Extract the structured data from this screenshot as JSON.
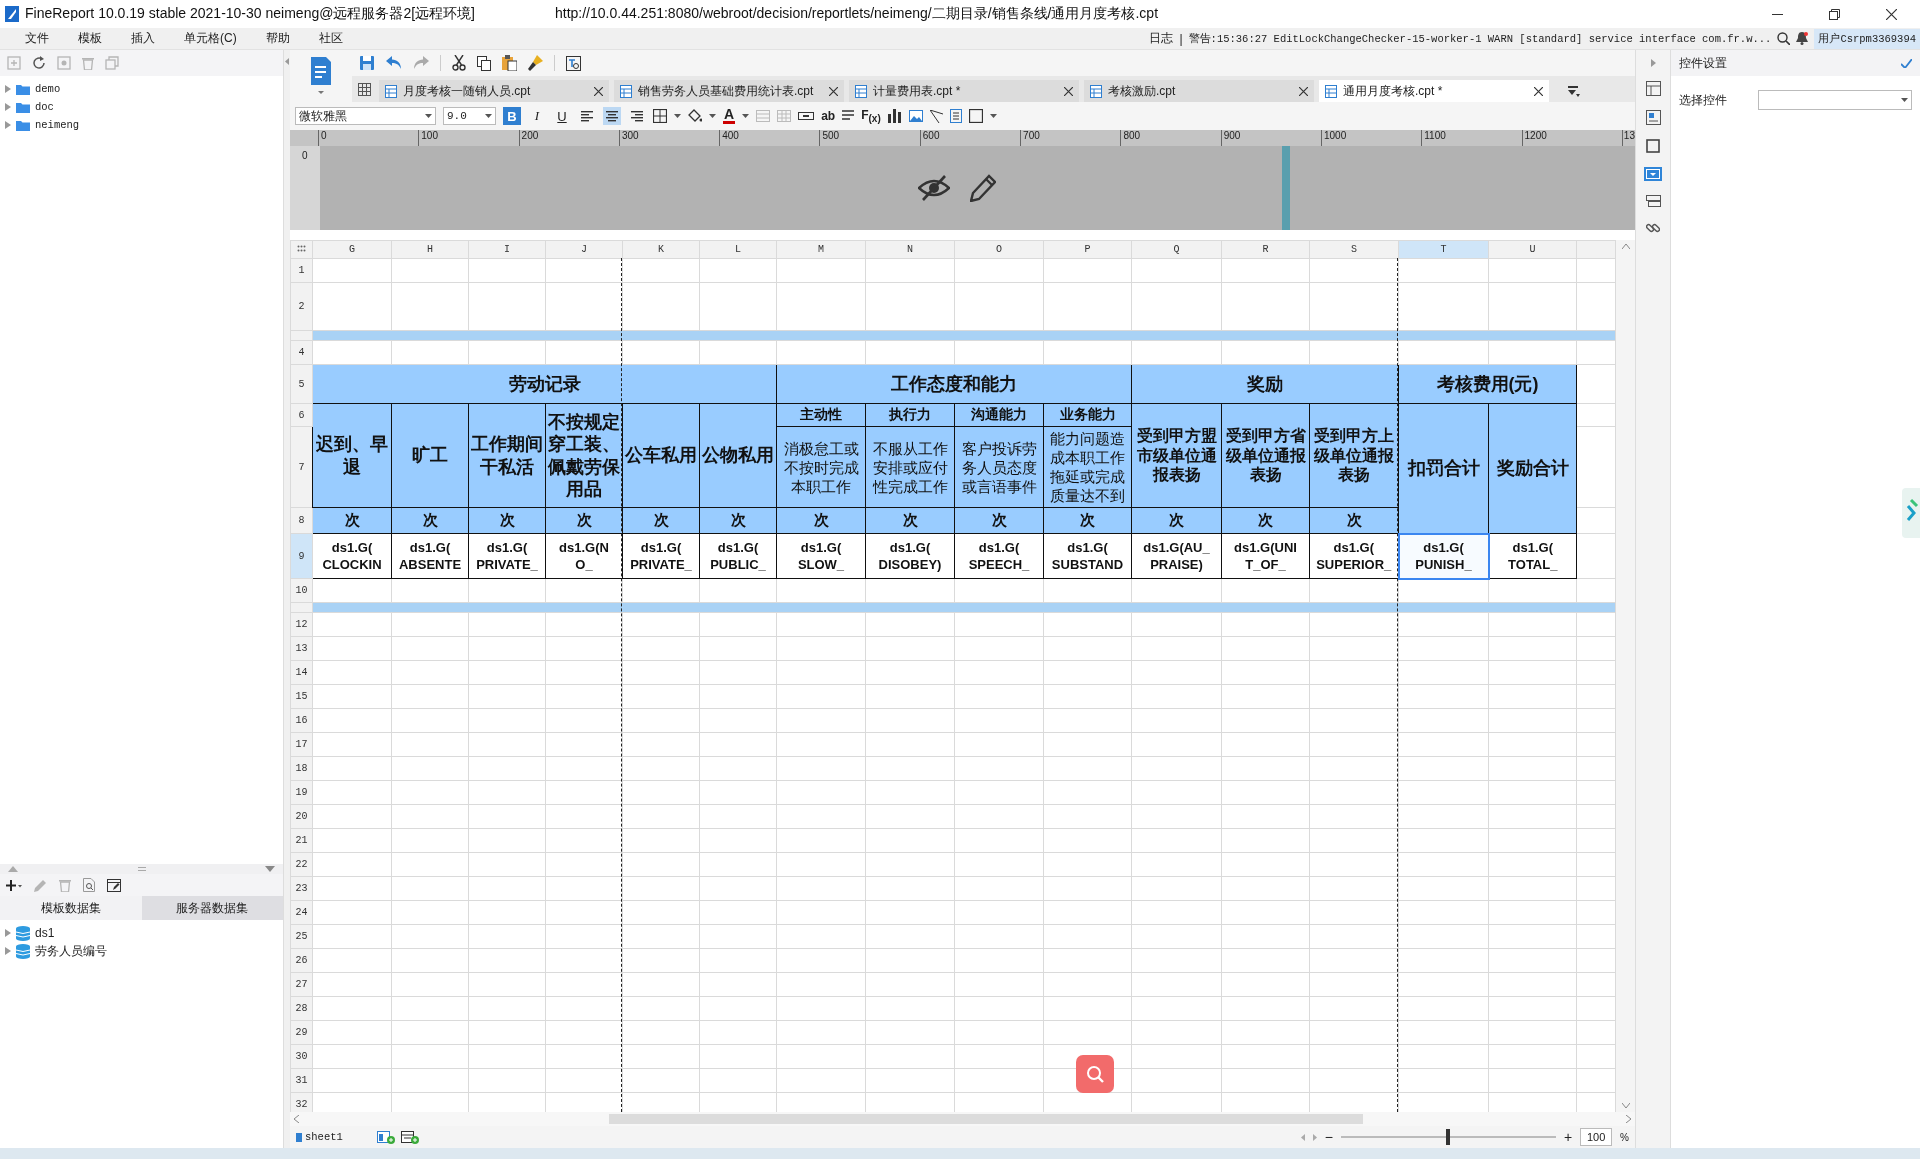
{
  "window": {
    "app_title": "FineReport 10.0.19 stable 2021-10-30 neimeng@远程服务器2[远程环境]",
    "url": "http://10.0.44.251:8080/webroot/decision/reportlets/neimeng/二期目录/销售条线/通用月度考核.cpt"
  },
  "menu": [
    "文件",
    "模板",
    "插入",
    "单元格(C)",
    "帮助",
    "社区"
  ],
  "status": {
    "log": "日志",
    "separator": "|",
    "warning": "警告:15:36:27 EditLockChangeChecker-15-worker-1 WARN [standard] service interface com.fr.w...",
    "user": "用户Csrpm3369394"
  },
  "template_tree": [
    {
      "label": "demo",
      "expanded": false
    },
    {
      "label": "doc",
      "expanded": false
    },
    {
      "label": "neimeng",
      "expanded": false
    }
  ],
  "dataset_panel": {
    "tabs": [
      {
        "label": "模板数据集",
        "selected": true
      },
      {
        "label": "服务器数据集",
        "selected": false
      }
    ],
    "items": [
      {
        "label": "ds1",
        "expanded": false
      },
      {
        "label": "劳务人员编号",
        "expanded": false
      }
    ]
  },
  "tabs": [
    {
      "label": "月度考核一随销人员.cpt",
      "selected": false
    },
    {
      "label": "销售劳务人员基础费用统计表.cpt",
      "selected": false
    },
    {
      "label": "计量费用表.cpt *",
      "selected": false
    },
    {
      "label": "考核激励.cpt",
      "selected": false
    },
    {
      "label": "通用月度考核.cpt *",
      "selected": true
    }
  ],
  "format_toolbar": {
    "font": "微软雅黑",
    "size": "9.0",
    "styles": [
      {
        "label": "B",
        "selected": true
      },
      {
        "label": "I",
        "selected": false
      },
      {
        "label": "U",
        "selected": false
      }
    ],
    "align": [
      {
        "kind": "left",
        "selected": false
      },
      {
        "kind": "center",
        "selected": true
      },
      {
        "kind": "right",
        "selected": false
      }
    ],
    "font_color": "A",
    "text_tool": "ab",
    "formula_tool": "F$_{(x)}$"
  },
  "ruler": [
    "0",
    "100",
    "200",
    "300",
    "400",
    "500",
    "600",
    "700",
    "800",
    "900",
    "1000",
    "1100",
    "1200",
    "13"
  ],
  "vertical_ruler": "0",
  "sheet": {
    "columns": [
      {
        "label": "G",
        "selected": false
      },
      {
        "label": "H",
        "selected": false
      },
      {
        "label": "I",
        "selected": false
      },
      {
        "label": "J",
        "selected": false
      },
      {
        "label": "K",
        "selected": false
      },
      {
        "label": "L",
        "selected": false
      },
      {
        "label": "M",
        "selected": false
      },
      {
        "label": "N",
        "selected": false
      },
      {
        "label": "O",
        "selected": false
      },
      {
        "label": "P",
        "selected": false
      },
      {
        "label": "Q",
        "selected": false
      },
      {
        "label": "R",
        "selected": false
      },
      {
        "label": "S",
        "selected": false
      },
      {
        "label": "T",
        "selected": true
      },
      {
        "label": "U",
        "selected": false
      }
    ],
    "rows": [
      {
        "kind": "cells",
        "label": "1",
        "selected": false
      },
      {
        "kind": "cells",
        "label": "2",
        "selected": false
      },
      {
        "kind": "band"
      },
      {
        "kind": "cells",
        "label": "4",
        "selected": false
      },
      {
        "kind": "report",
        "label": "5",
        "selected": false
      },
      {
        "kind": "report",
        "label": "6",
        "selected": false
      },
      {
        "kind": "report",
        "label": "7",
        "selected": false
      },
      {
        "kind": "report",
        "label": "8",
        "selected": false
      },
      {
        "kind": "report",
        "label": "9",
        "selected": true
      },
      {
        "kind": "cells",
        "label": "10",
        "selected": false
      },
      {
        "kind": "band"
      },
      {
        "kind": "cells",
        "label": "12",
        "selected": false
      },
      {
        "kind": "cells",
        "label": "13",
        "selected": false
      },
      {
        "kind": "cells",
        "label": "14",
        "selected": false
      },
      {
        "kind": "cells",
        "label": "15",
        "selected": false
      },
      {
        "kind": "cells",
        "label": "16",
        "selected": false
      },
      {
        "kind": "cells",
        "label": "17",
        "selected": false
      },
      {
        "kind": "cells",
        "label": "18",
        "selected": false
      },
      {
        "kind": "cells",
        "label": "19",
        "selected": false
      },
      {
        "kind": "cells",
        "label": "20",
        "selected": false
      },
      {
        "kind": "cells",
        "label": "21",
        "selected": false
      },
      {
        "kind": "cells",
        "label": "22",
        "selected": false
      },
      {
        "kind": "cells",
        "label": "23",
        "selected": false
      },
      {
        "kind": "cells",
        "label": "24",
        "selected": false
      },
      {
        "kind": "cells",
        "label": "25",
        "selected": false
      },
      {
        "kind": "cells",
        "label": "26",
        "selected": false
      },
      {
        "kind": "cells",
        "label": "27",
        "selected": false
      },
      {
        "kind": "cells",
        "label": "28",
        "selected": false
      },
      {
        "kind": "cells",
        "label": "29",
        "selected": false
      },
      {
        "kind": "cells",
        "label": "30",
        "selected": false
      },
      {
        "kind": "cells",
        "label": "31",
        "selected": false
      },
      {
        "kind": "cells",
        "label": "32",
        "selected": false
      }
    ],
    "report": {
      "groups": [
        {
          "title": "劳动记录",
          "columns": [
            {
              "title": "迟到、早退",
              "unit": "次",
              "formula": [
                "ds1.G(",
                "CLOCKIN"
              ],
              "selected": false
            },
            {
              "title": "旷工",
              "unit": "次",
              "formula": [
                "ds1.G(",
                "ABSENTE"
              ],
              "selected": false
            },
            {
              "title": "工作期间干私活",
              "unit": "次",
              "formula": [
                "ds1.G(",
                "PRIVATE_"
              ],
              "selected": false
            },
            {
              "title": "不按规定穿工装、佩戴劳保用品",
              "unit": "次",
              "formula": [
                "ds1.G(N",
                "O_"
              ],
              "selected": false
            },
            {
              "title": "公车私用",
              "unit": "次",
              "formula": [
                "ds1.G(",
                "PRIVATE_"
              ],
              "selected": false
            },
            {
              "title": "公物私用",
              "unit": "次",
              "formula": [
                "ds1.G(",
                "PUBLIC_"
              ],
              "selected": false
            }
          ]
        },
        {
          "title": "工作态度和能力",
          "columns": [
            {
              "category": "主动性",
              "title": "消极怠工或不按时完成本职工作",
              "unit": "次",
              "formula": [
                "ds1.G(",
                "SLOW_"
              ],
              "selected": false
            },
            {
              "category": "执行力",
              "title": "不服从工作安排或应付性完成工作",
              "unit": "次",
              "formula": [
                "ds1.G(",
                "DISOBEY)"
              ],
              "selected": false
            },
            {
              "category": "沟通能力",
              "title": "客户投诉劳务人员态度或言语事件",
              "unit": "次",
              "formula": [
                "ds1.G(",
                "SPEECH_"
              ],
              "selected": false
            },
            {
              "category": "业务能力",
              "title": "能力问题造成本职工作拖延或完成质量达不到",
              "unit": "次",
              "formula": [
                "ds1.G(",
                "SUBSTAND"
              ],
              "selected": false
            }
          ]
        },
        {
          "title": "奖励",
          "columns": [
            {
              "title": "受到甲方盟市级单位通报表扬",
              "unit": "次",
              "formula": [
                "ds1.G(AU_",
                "PRAISE)"
              ],
              "selected": false
            },
            {
              "title": "受到甲方省级单位通报表扬",
              "unit": "次",
              "formula": [
                "ds1.G(UNI",
                "T_OF_"
              ],
              "selected": false
            },
            {
              "title": "受到甲方上级单位通报表扬",
              "unit": "次",
              "formula": [
                "ds1.G(",
                "SUPERIOR_"
              ],
              "selected": false
            }
          ]
        },
        {
          "title": "考核费用(元)",
          "columns": [
            {
              "title": "扣罚合计",
              "formula": [
                "ds1.G(",
                "PUNISH_"
              ],
              "selected": true
            },
            {
              "title": "奖励合计",
              "formula": [
                "ds1.G(",
                "TOTAL_"
              ],
              "selected": false
            }
          ]
        }
      ]
    }
  },
  "sheet_tabs": [
    {
      "label": "sheet1"
    }
  ],
  "zoom": {
    "minus": "−",
    "plus": "+",
    "level": 0.5,
    "value": "100",
    "unit": "%"
  },
  "control_settings": {
    "title": "控件设置",
    "field_label": "选择控件"
  }
}
